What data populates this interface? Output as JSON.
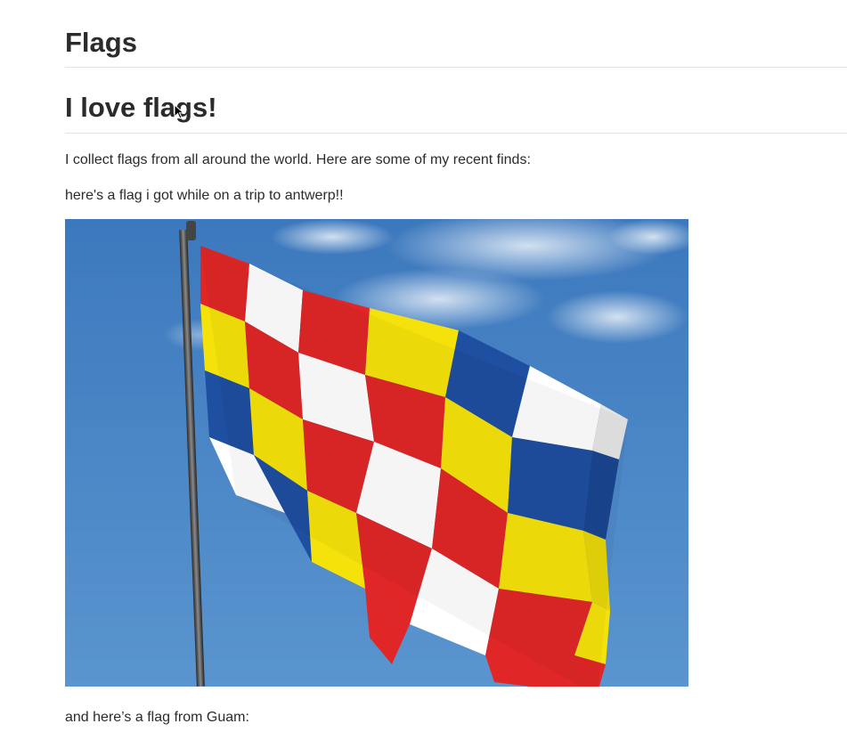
{
  "site": {
    "title": "Flags"
  },
  "post": {
    "title": "I love flags!",
    "intro": "I collect flags from all around the world. Here are some of my recent finds:",
    "caption_1": "here's a flag i got while on a trip to antwerp!!",
    "caption_2": "and here’s a flag from Guam:"
  },
  "images": {
    "flag_1": {
      "alt": "Flag of Antwerp",
      "sky_color": "#4a86c5",
      "colors": [
        "#e02626",
        "#ffffff",
        "#f5e20a",
        "#1f4fa0"
      ]
    }
  },
  "icons": {
    "cursor": "mouse-pointer-icon"
  }
}
